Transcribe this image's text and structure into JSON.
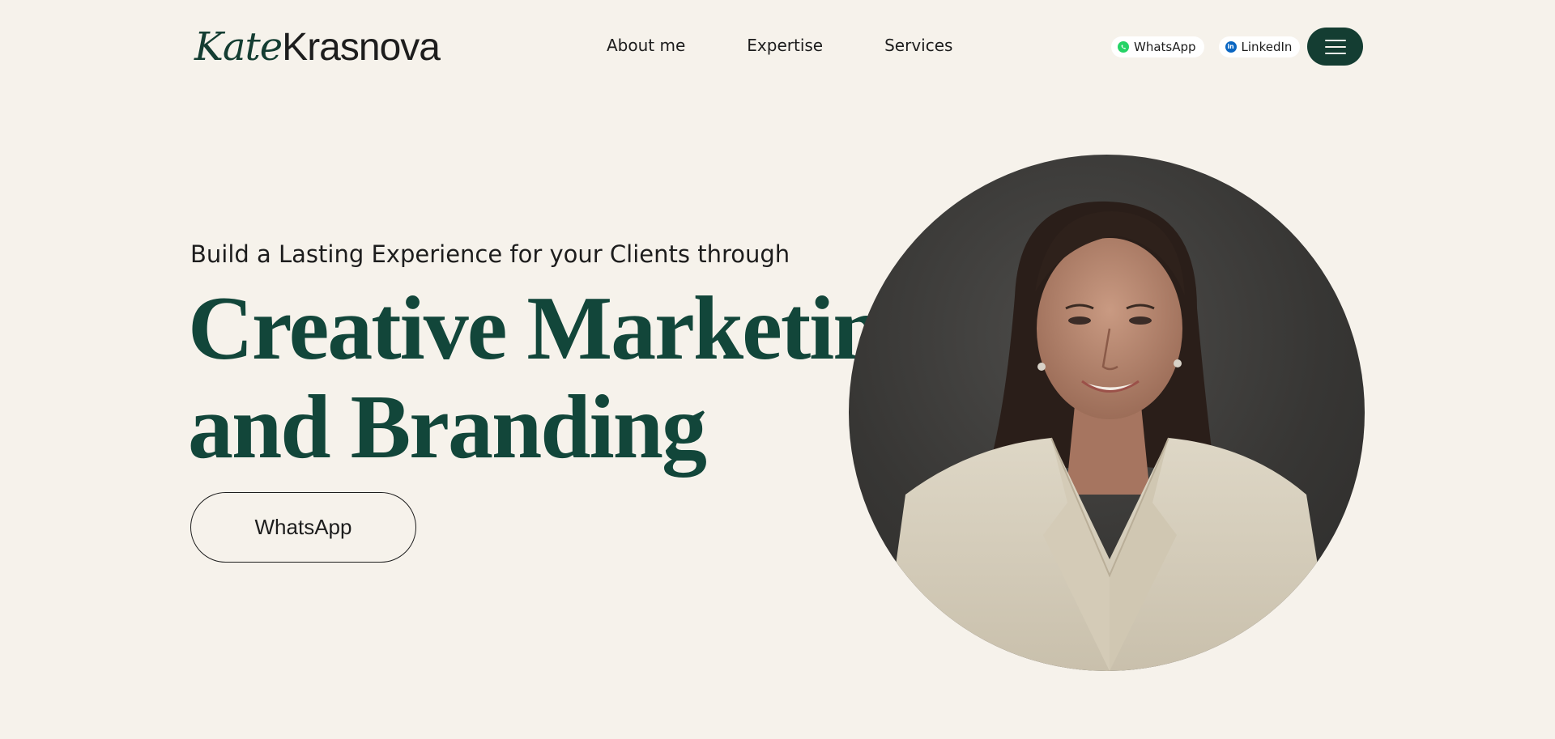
{
  "logo": {
    "first": "Kate",
    "last": "Krasnova"
  },
  "nav": [
    {
      "label": "About me"
    },
    {
      "label": "Expertise"
    },
    {
      "label": "Services"
    }
  ],
  "social": {
    "whatsapp": {
      "label": "WhatsApp",
      "icon": "whatsapp-icon"
    },
    "linkedin": {
      "label": "LinkedIn",
      "icon": "linkedin-icon"
    }
  },
  "menu": {
    "icon": "hamburger-menu-icon"
  },
  "hero": {
    "subtitle": "Build a Lasting Experience for your Clients through",
    "headline_line1": "Creative Marketing",
    "headline_line2": "and Branding",
    "cta_label": "WhatsApp"
  },
  "colors": {
    "background": "#f6f2eb",
    "accent": "#143d32",
    "headline": "#12463a",
    "text": "#1d1d1d"
  }
}
